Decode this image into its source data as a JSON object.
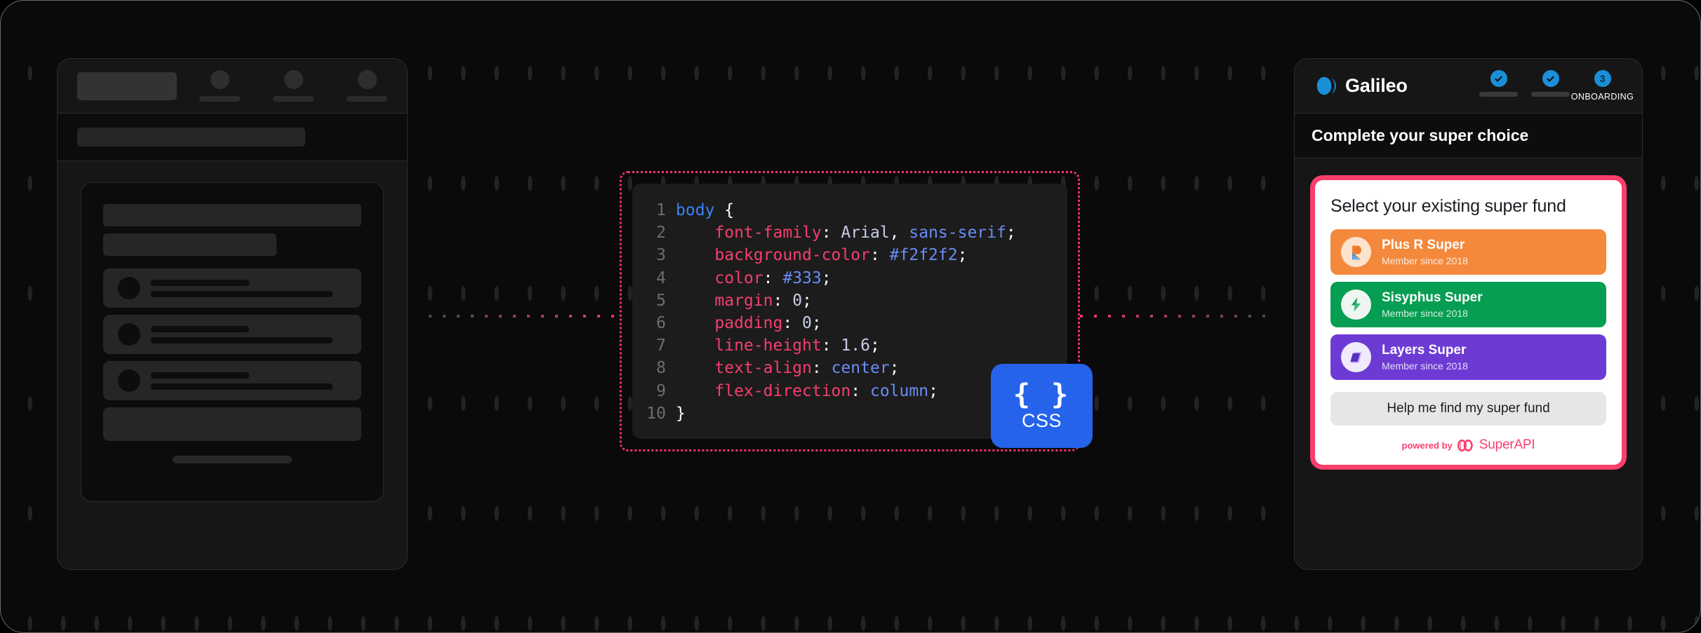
{
  "colors": {
    "accent_pink": "#fa3f6c",
    "dotted_border": "#f4336b",
    "css_badge_blue": "#2563eb",
    "galileo_blue": "#1a8fd8",
    "fund_orange": "#f4893c",
    "fund_green": "#069e52",
    "fund_purple": "#6d3bd4",
    "page_bg": "#0a0a0a"
  },
  "wireframe": {
    "name": "app-wireframe-skeleton",
    "nav_item_count": 3,
    "list_row_count": 3
  },
  "code_panel": {
    "language_badge": {
      "braces": "{ }",
      "label": "CSS"
    },
    "lines": [
      {
        "number": "1",
        "tokens": [
          {
            "t": "sel",
            "v": "body"
          },
          {
            "t": "pun",
            "v": " {"
          }
        ]
      },
      {
        "number": "2",
        "tokens": [
          {
            "t": "pun",
            "v": "    "
          },
          {
            "t": "prop",
            "v": "font-family"
          },
          {
            "t": "pun",
            "v": ": "
          },
          {
            "t": "valw",
            "v": "Arial"
          },
          {
            "t": "pun",
            "v": ", "
          },
          {
            "t": "val",
            "v": "sans-serif"
          },
          {
            "t": "pun",
            "v": ";"
          }
        ]
      },
      {
        "number": "3",
        "tokens": [
          {
            "t": "pun",
            "v": "    "
          },
          {
            "t": "prop",
            "v": "background-color"
          },
          {
            "t": "pun",
            "v": ": "
          },
          {
            "t": "val",
            "v": "#f2f2f2"
          },
          {
            "t": "pun",
            "v": ";"
          }
        ]
      },
      {
        "number": "4",
        "tokens": [
          {
            "t": "pun",
            "v": "    "
          },
          {
            "t": "prop",
            "v": "color"
          },
          {
            "t": "pun",
            "v": ": "
          },
          {
            "t": "val",
            "v": "#333"
          },
          {
            "t": "pun",
            "v": ";"
          }
        ]
      },
      {
        "number": "5",
        "tokens": [
          {
            "t": "pun",
            "v": "    "
          },
          {
            "t": "prop",
            "v": "margin"
          },
          {
            "t": "pun",
            "v": ": "
          },
          {
            "t": "valw",
            "v": "0"
          },
          {
            "t": "pun",
            "v": ";"
          }
        ]
      },
      {
        "number": "6",
        "tokens": [
          {
            "t": "pun",
            "v": "    "
          },
          {
            "t": "prop",
            "v": "padding"
          },
          {
            "t": "pun",
            "v": ": "
          },
          {
            "t": "valw",
            "v": "0"
          },
          {
            "t": "pun",
            "v": ";"
          }
        ]
      },
      {
        "number": "7",
        "tokens": [
          {
            "t": "pun",
            "v": "    "
          },
          {
            "t": "prop",
            "v": "line-height"
          },
          {
            "t": "pun",
            "v": ": "
          },
          {
            "t": "valw",
            "v": "1.6"
          },
          {
            "t": "pun",
            "v": ";"
          }
        ]
      },
      {
        "number": "8",
        "tokens": [
          {
            "t": "pun",
            "v": "    "
          },
          {
            "t": "prop",
            "v": "text-align"
          },
          {
            "t": "pun",
            "v": ": "
          },
          {
            "t": "val",
            "v": "center"
          },
          {
            "t": "pun",
            "v": ";"
          }
        ]
      },
      {
        "number": "9",
        "tokens": [
          {
            "t": "pun",
            "v": "    "
          },
          {
            "t": "prop",
            "v": "flex-direction"
          },
          {
            "t": "pun",
            "v": ": "
          },
          {
            "t": "val",
            "v": "column"
          },
          {
            "t": "pun",
            "v": ";"
          }
        ]
      },
      {
        "number": "10",
        "tokens": [
          {
            "t": "pun",
            "v": "}"
          }
        ]
      }
    ]
  },
  "galileo": {
    "brand": "Galileo",
    "steps": [
      {
        "state": "complete",
        "label": ""
      },
      {
        "state": "complete",
        "label": ""
      },
      {
        "state": "current",
        "number": "3",
        "label": "ONBOARDING"
      }
    ],
    "page_title": "Complete your super choice",
    "widget": {
      "heading": "Select your existing super fund",
      "funds": [
        {
          "name": "Plus R Super",
          "meta": "Member since 2018",
          "color": "#f4893c",
          "logo": "plus-r-super-logo"
        },
        {
          "name": "Sisyphus Super",
          "meta": "Member since 2018",
          "color": "#069e52",
          "logo": "sisyphus-super-logo"
        },
        {
          "name": "Layers Super",
          "meta": "Member since 2018",
          "color": "#6d3bd4",
          "logo": "layers-super-logo"
        }
      ],
      "help_button": "Help me find my super fund",
      "powered_by_prefix": "powered by",
      "powered_by_name": "SuperAPI"
    }
  }
}
